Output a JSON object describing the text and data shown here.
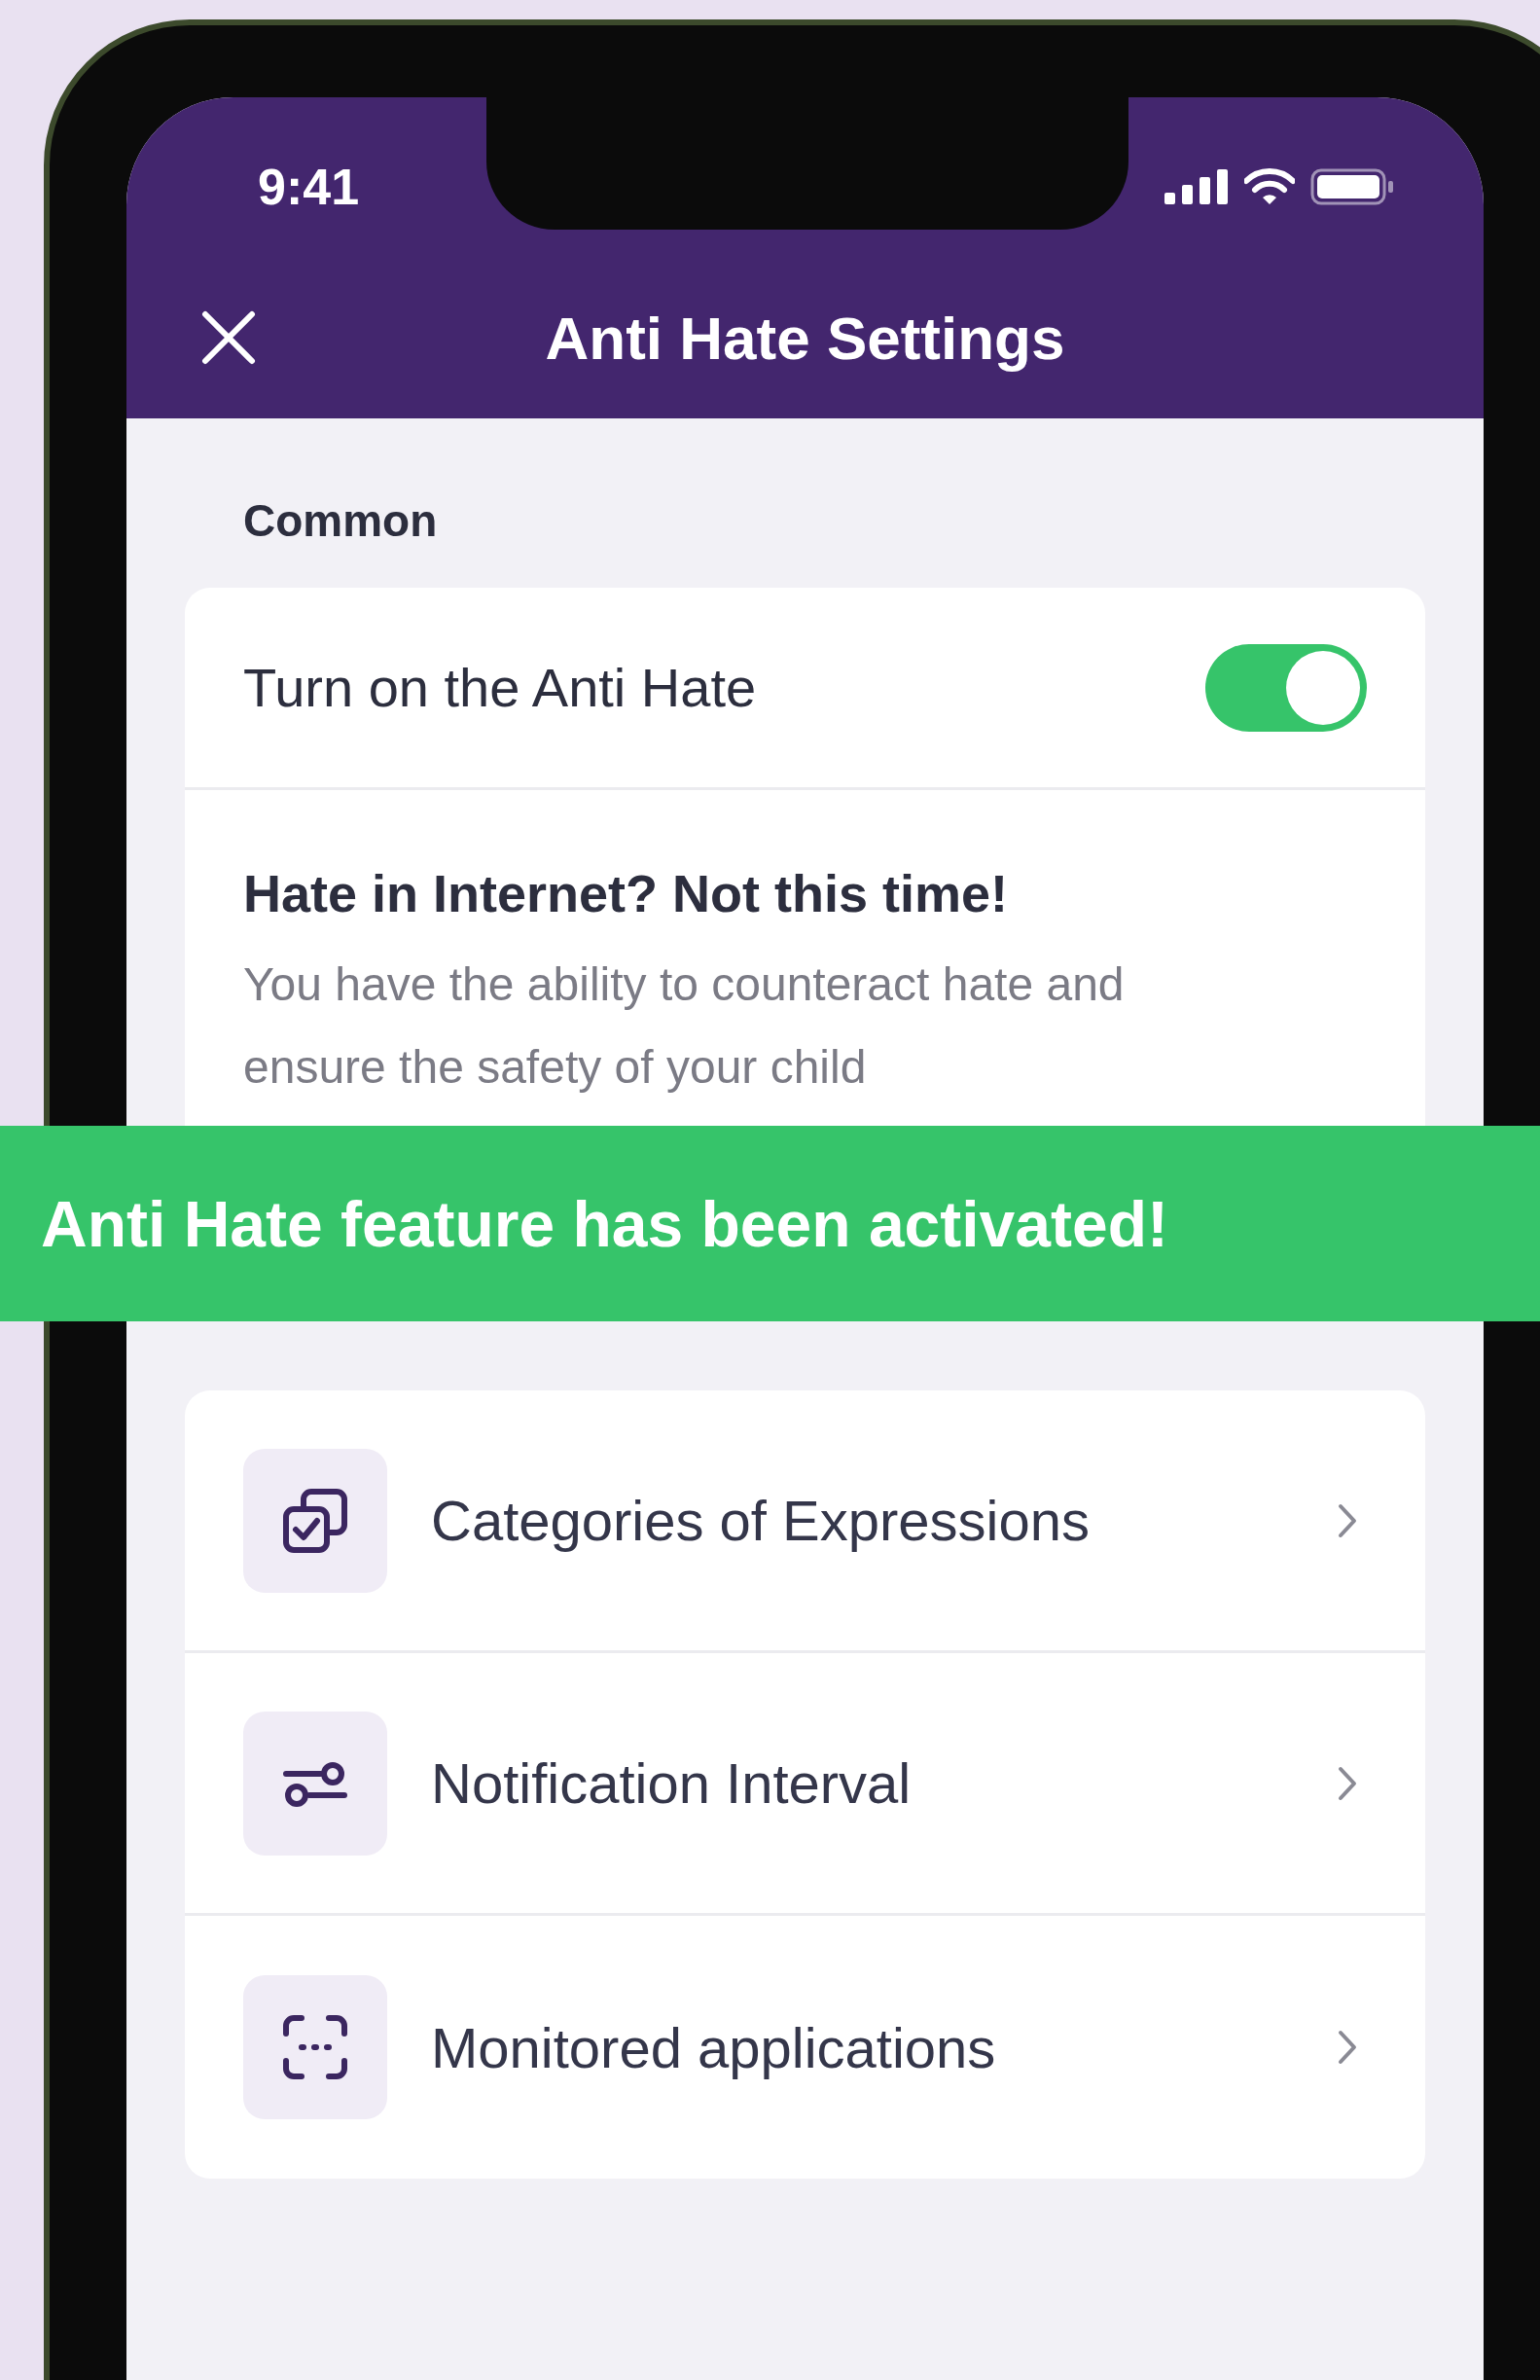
{
  "status_bar": {
    "time": "9:41"
  },
  "header": {
    "title": "Anti Hate Settings"
  },
  "common": {
    "label": "Common",
    "toggle": {
      "label": "Turn on the Anti Hate",
      "on": true
    },
    "info": {
      "heading": "Hate in Internet? Not this time!",
      "text": "You have the ability to counteract hate and ensure the safety of your child"
    }
  },
  "banner": {
    "text": "Anti Hate feature has been activated!"
  },
  "settings": [
    {
      "kind": "categories",
      "label": "Categories of Expressions"
    },
    {
      "kind": "interval",
      "label": "Notification Interval"
    },
    {
      "kind": "apps",
      "label": "Monitored applications"
    }
  ]
}
